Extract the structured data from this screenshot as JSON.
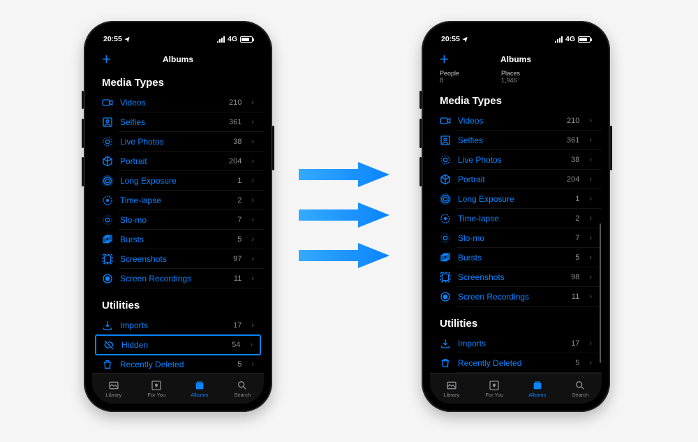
{
  "status": {
    "time": "20:55",
    "network": "4G"
  },
  "nav": {
    "title": "Albums",
    "add_label": "+"
  },
  "sections": {
    "media_title": "Media Types",
    "utilities_title": "Utilities"
  },
  "left_phone": {
    "media": [
      {
        "icon": "video-icon",
        "label": "Videos",
        "count": "210"
      },
      {
        "icon": "selfie-icon",
        "label": "Selfies",
        "count": "361"
      },
      {
        "icon": "livephoto-icon",
        "label": "Live Photos",
        "count": "38"
      },
      {
        "icon": "cube-icon",
        "label": "Portrait",
        "count": "204"
      },
      {
        "icon": "longexposure-icon",
        "label": "Long Exposure",
        "count": "1"
      },
      {
        "icon": "timelapse-icon",
        "label": "Time-lapse",
        "count": "2"
      },
      {
        "icon": "slomo-icon",
        "label": "Slo-mo",
        "count": "7"
      },
      {
        "icon": "bursts-icon",
        "label": "Bursts",
        "count": "5"
      },
      {
        "icon": "screenshot-icon",
        "label": "Screenshots",
        "count": "97"
      },
      {
        "icon": "screenrec-icon",
        "label": "Screen Recordings",
        "count": "11"
      }
    ],
    "utilities": [
      {
        "icon": "import-icon",
        "label": "Imports",
        "count": "17",
        "highlight": false
      },
      {
        "icon": "hidden-icon",
        "label": "Hidden",
        "count": "54",
        "highlight": true
      },
      {
        "icon": "trash-icon",
        "label": "Recently Deleted",
        "count": "5",
        "highlight": false
      }
    ]
  },
  "right_phone": {
    "top_mini": {
      "people_label": "People",
      "people_count": "8",
      "places_label": "Places",
      "places_count": "1,946"
    },
    "media": [
      {
        "icon": "video-icon",
        "label": "Videos",
        "count": "210"
      },
      {
        "icon": "selfie-icon",
        "label": "Selfies",
        "count": "361"
      },
      {
        "icon": "livephoto-icon",
        "label": "Live Photos",
        "count": "38"
      },
      {
        "icon": "cube-icon",
        "label": "Portrait",
        "count": "204"
      },
      {
        "icon": "longexposure-icon",
        "label": "Long Exposure",
        "count": "1"
      },
      {
        "icon": "timelapse-icon",
        "label": "Time-lapse",
        "count": "2"
      },
      {
        "icon": "slomo-icon",
        "label": "Slo-mo",
        "count": "7"
      },
      {
        "icon": "bursts-icon",
        "label": "Bursts",
        "count": "5"
      },
      {
        "icon": "screenshot-icon",
        "label": "Screenshots",
        "count": "98"
      },
      {
        "icon": "screenrec-icon",
        "label": "Screen Recordings",
        "count": "11"
      }
    ],
    "utilities": [
      {
        "icon": "import-icon",
        "label": "Imports",
        "count": "17"
      },
      {
        "icon": "trash-icon",
        "label": "Recently Deleted",
        "count": "5"
      }
    ]
  },
  "tabs": [
    {
      "name": "library",
      "label": "Library",
      "active": false
    },
    {
      "name": "foryou",
      "label": "For You",
      "active": false
    },
    {
      "name": "albums",
      "label": "Albums",
      "active": true
    },
    {
      "name": "search",
      "label": "Search",
      "active": false
    }
  ]
}
